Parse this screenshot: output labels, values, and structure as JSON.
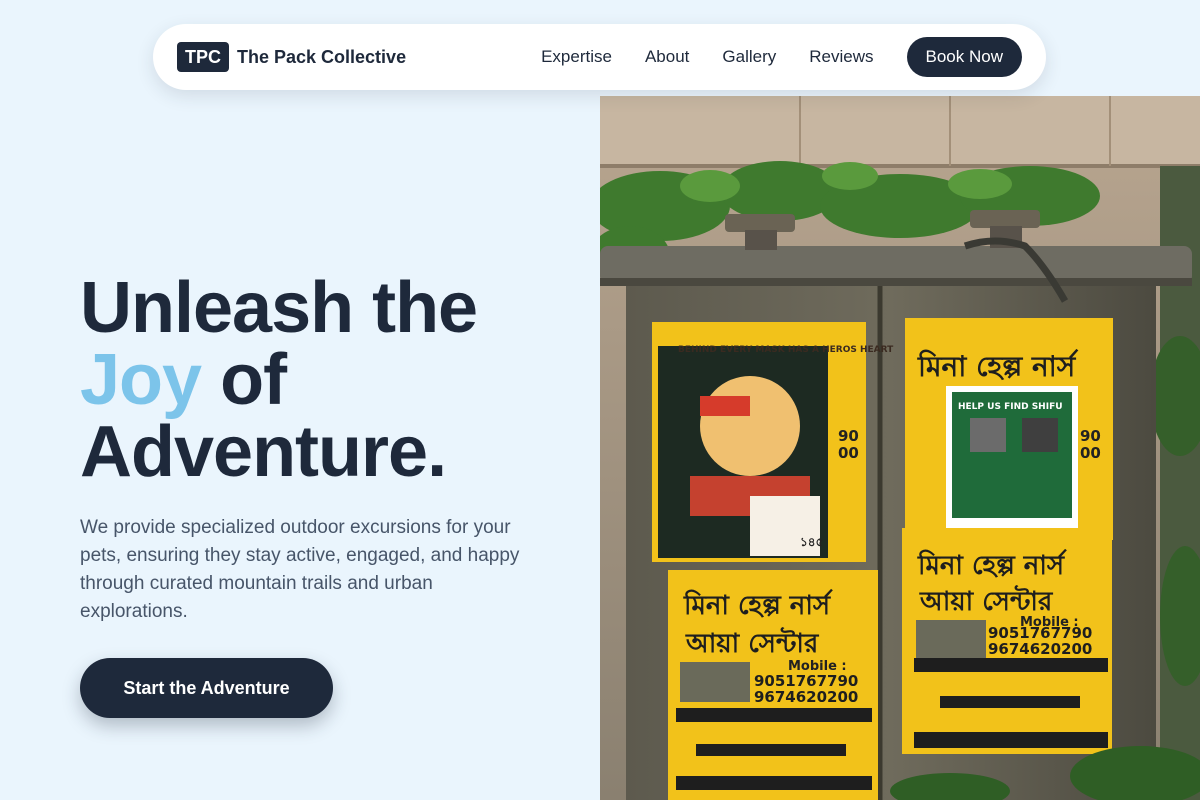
{
  "nav": {
    "logo_badge": "TPC",
    "brand_name": "The Pack Collective",
    "links": [
      "Expertise",
      "About",
      "Gallery",
      "Reviews"
    ],
    "cta": "Book Now"
  },
  "hero": {
    "title_line1": "Unleash the",
    "title_accent": "Joy",
    "title_line2_rest": " of",
    "title_line3": "Adventure.",
    "description": "We provide specialized outdoor excursions for your pets, ensuring they stay active, engaged, and happy through curated mountain trails and urban explorations.",
    "cta": "Start the Adventure"
  },
  "image": {
    "poster_texts": {
      "phone1": "9051767790",
      "phone2": "9674620200",
      "mobile_label": "Mobile :",
      "lost_pet": "HELP US FIND SHIFU",
      "poster_caption": "BEHIND EVERY MASK HAS A HEROS HEART"
    }
  },
  "colors": {
    "primary": "#1e293b",
    "accent": "#7cc4ea",
    "background": "#eaf5fd",
    "poster_yellow": "#f2c21a"
  },
  "icons": {
    "logo": "tpc-logo-badge"
  }
}
